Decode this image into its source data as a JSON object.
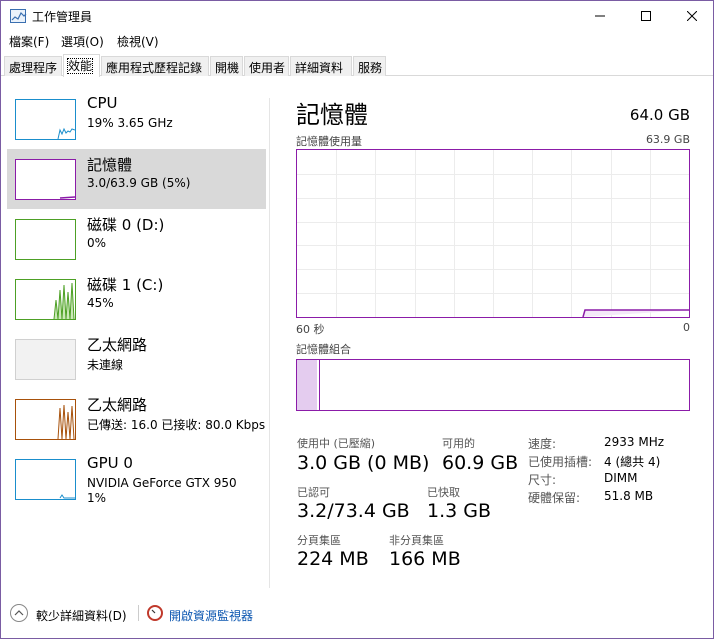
{
  "window": {
    "title": "工作管理員"
  },
  "menu": [
    {
      "label": "檔案(F)"
    },
    {
      "label": "選項(O)"
    },
    {
      "label": "檢視(V)"
    }
  ],
  "tabs": [
    {
      "label": "處理程序"
    },
    {
      "label": "效能"
    },
    {
      "label": "應用程式歷程記錄"
    },
    {
      "label": "開機"
    },
    {
      "label": "使用者"
    },
    {
      "label": "詳細資料"
    },
    {
      "label": "服務"
    }
  ],
  "active_tab": "效能",
  "sidebar": [
    {
      "title": "CPU",
      "sub": "19%  3.65 GHz",
      "sub2": "",
      "color": "#1a8ecc"
    },
    {
      "title": "記憶體",
      "sub": "3.0/63.9 GB (5%)",
      "sub2": "",
      "color": "#8b1ba8"
    },
    {
      "title": "磁碟 0 (D:)",
      "sub": "0%",
      "sub2": "",
      "color": "#4da025"
    },
    {
      "title": "磁碟 1 (C:)",
      "sub": "45%",
      "sub2": "",
      "color": "#4da025"
    },
    {
      "title": "乙太網路",
      "sub": "未連線",
      "sub2": "",
      "color": "#bbbbbb"
    },
    {
      "title": "乙太網路",
      "sub": "已傳送: 16.0  已接收: 80.0 Kbps",
      "sub2": "",
      "color": "#a7510b"
    },
    {
      "title": "GPU 0",
      "sub": "NVIDIA GeForce GTX 950",
      "sub2": "1%",
      "color": "#1a8ecc"
    }
  ],
  "memory": {
    "title": "記憶體",
    "total": "64.0 GB",
    "usage_label": "記憶體使用量",
    "usage_max": "63.9 GB",
    "time_left": "60 秒",
    "time_right": "0",
    "composition_label": "記憶體組合",
    "composition_used_fraction": 0.05,
    "composition_modified_fraction": 0.005,
    "stats": {
      "in_use_label": "使用中 (已壓縮)",
      "in_use_value": "3.0 GB (0 MB)",
      "available_label": "可用的",
      "available_value": "60.9 GB",
      "committed_label": "已認可",
      "committed_value": "3.2/73.4 GB",
      "cached_label": "已快取",
      "cached_value": "1.3 GB",
      "paged_label": "分頁集區",
      "paged_value": "224 MB",
      "nonpaged_label": "非分頁集區",
      "nonpaged_value": "166 MB"
    },
    "details": [
      {
        "key": "速度:",
        "value": "2933 MHz"
      },
      {
        "key": "已使用插槽:",
        "value": "4 (總共 4)"
      },
      {
        "key": "尺寸:",
        "value": "DIMM"
      },
      {
        "key": "硬體保留:",
        "value": "51.8 MB"
      }
    ]
  },
  "footer": {
    "fewer_details": "較少詳細資料(D)",
    "open_resmon": "開啟資源監視器"
  },
  "colors": {
    "memory_accent": "#8b1ba8",
    "link": "#0b56b0"
  }
}
